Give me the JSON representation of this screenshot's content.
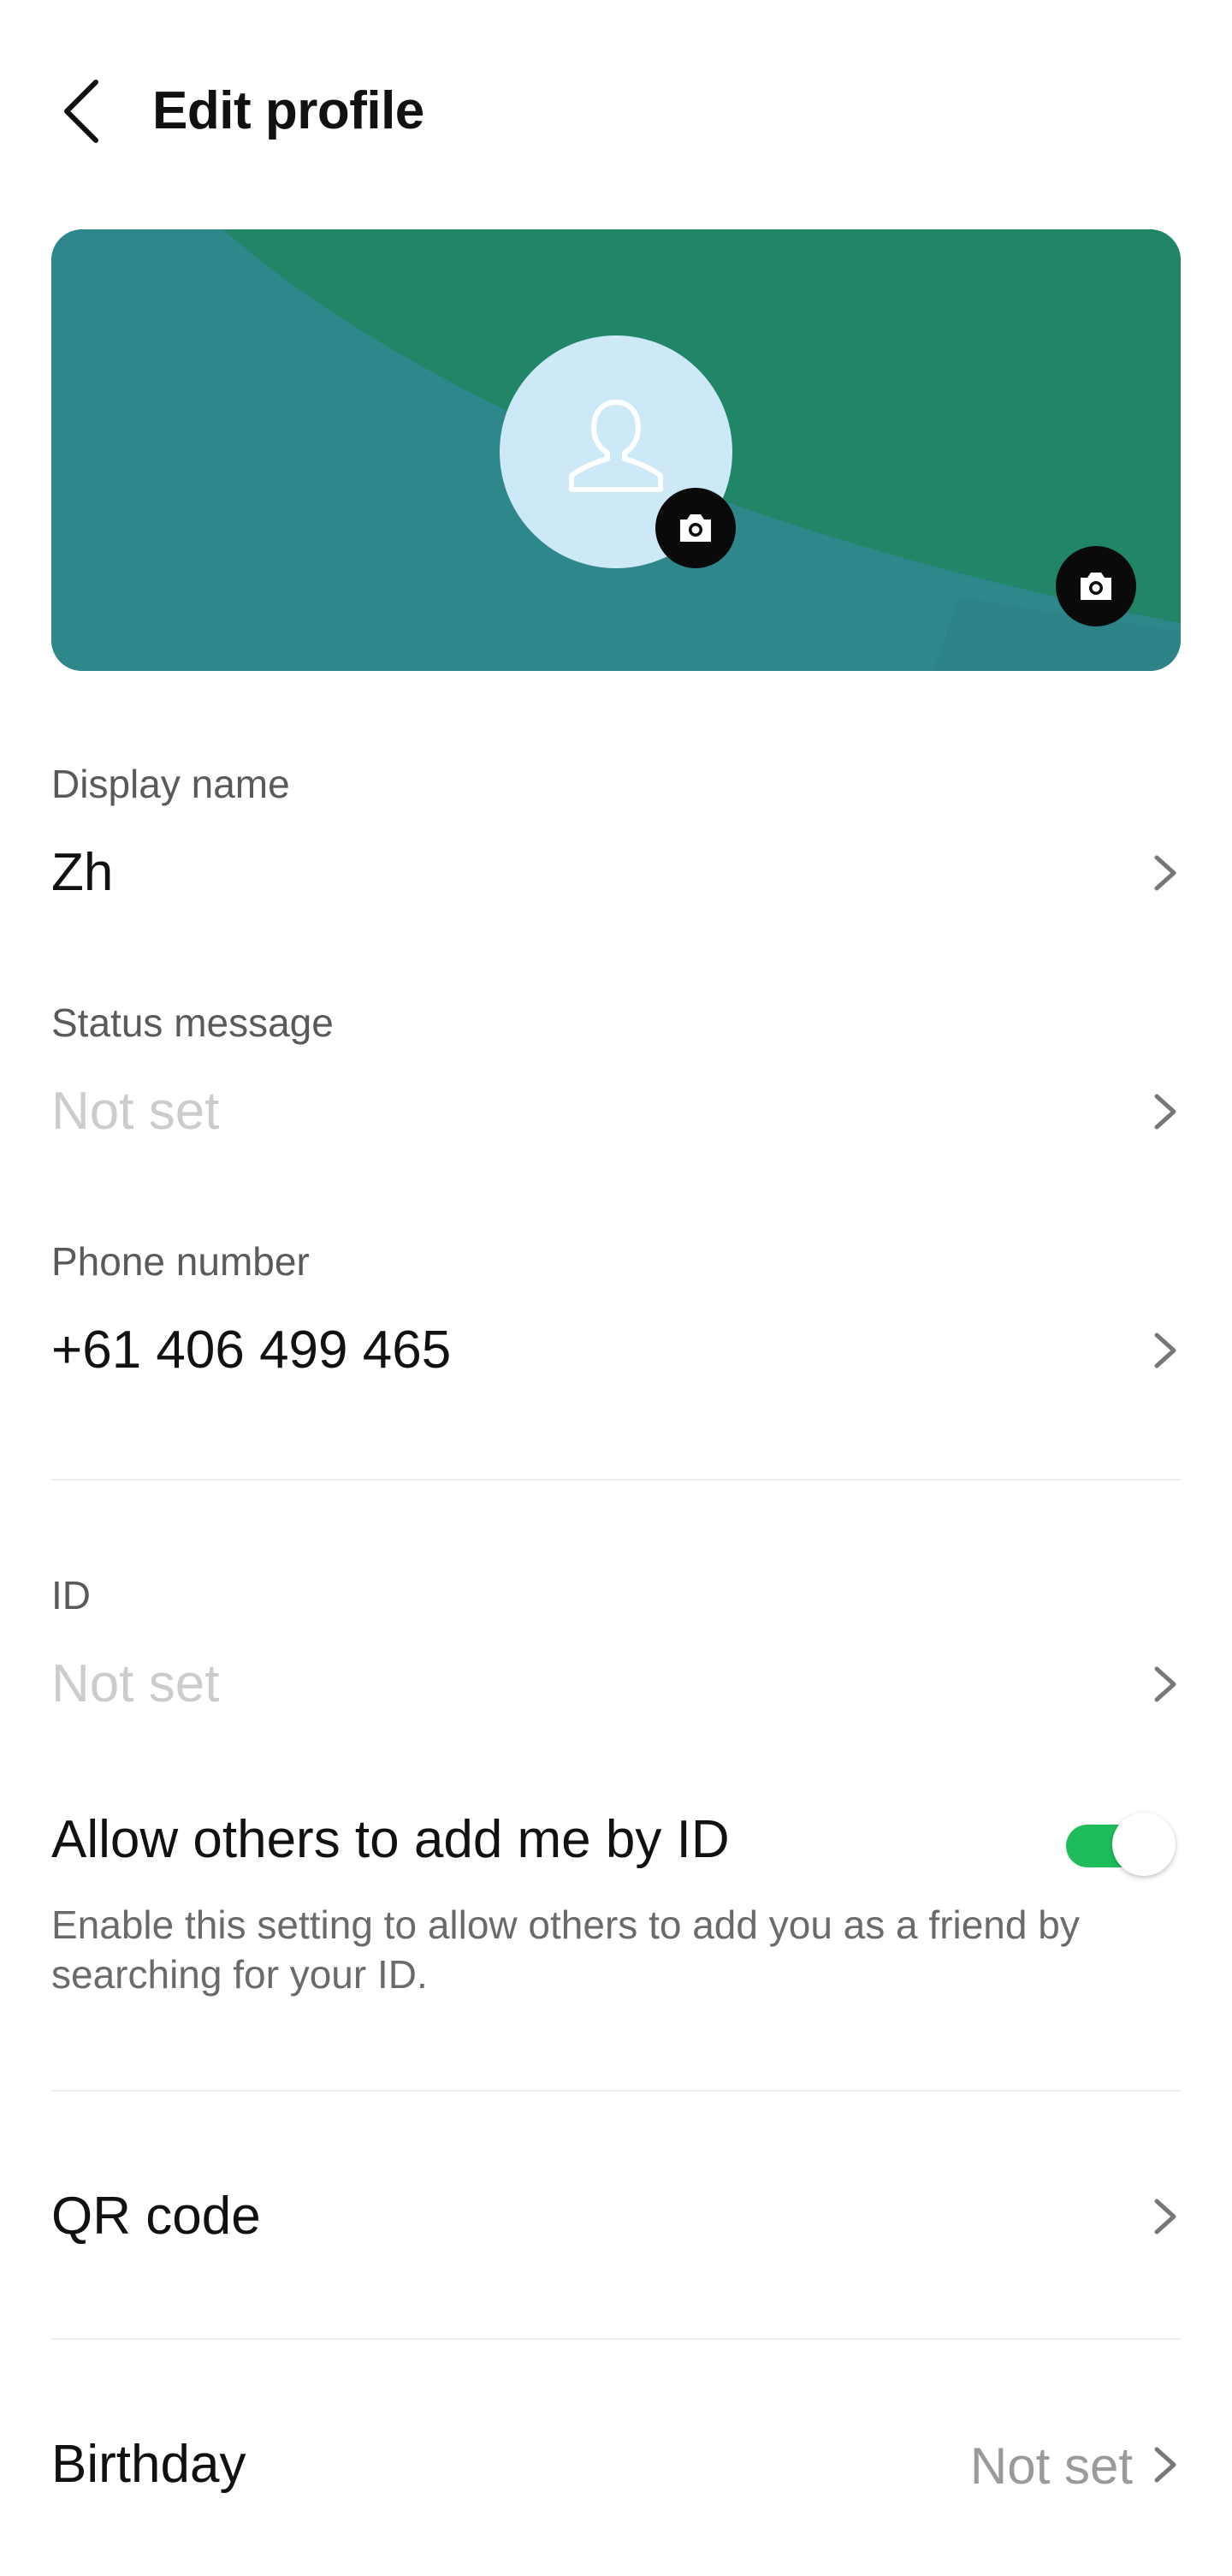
{
  "header": {
    "title": "Edit profile"
  },
  "profile": {
    "avatar_icon": "person-outline-icon",
    "camera_icon": "camera-icon",
    "colors": {
      "cover_teal": "#2e878a",
      "cover_green": "#218668",
      "avatar_bg": "#cde9f7",
      "toggle_on": "#1ebd5a"
    }
  },
  "fields": {
    "display_name": {
      "label": "Display name",
      "value": "Zh"
    },
    "status_message": {
      "label": "Status message",
      "value": "Not set"
    },
    "phone_number": {
      "label": "Phone number",
      "value": "+61 406 499 465"
    },
    "id": {
      "label": "ID",
      "value": "Not set"
    }
  },
  "allow_add_by_id": {
    "title": "Allow others to add me by ID",
    "description": "Enable this setting to allow others to add you as a friend by searching for your ID.",
    "enabled": true
  },
  "qr_code": {
    "label": "QR code"
  },
  "birthday": {
    "label": "Birthday",
    "value": "Not set"
  }
}
